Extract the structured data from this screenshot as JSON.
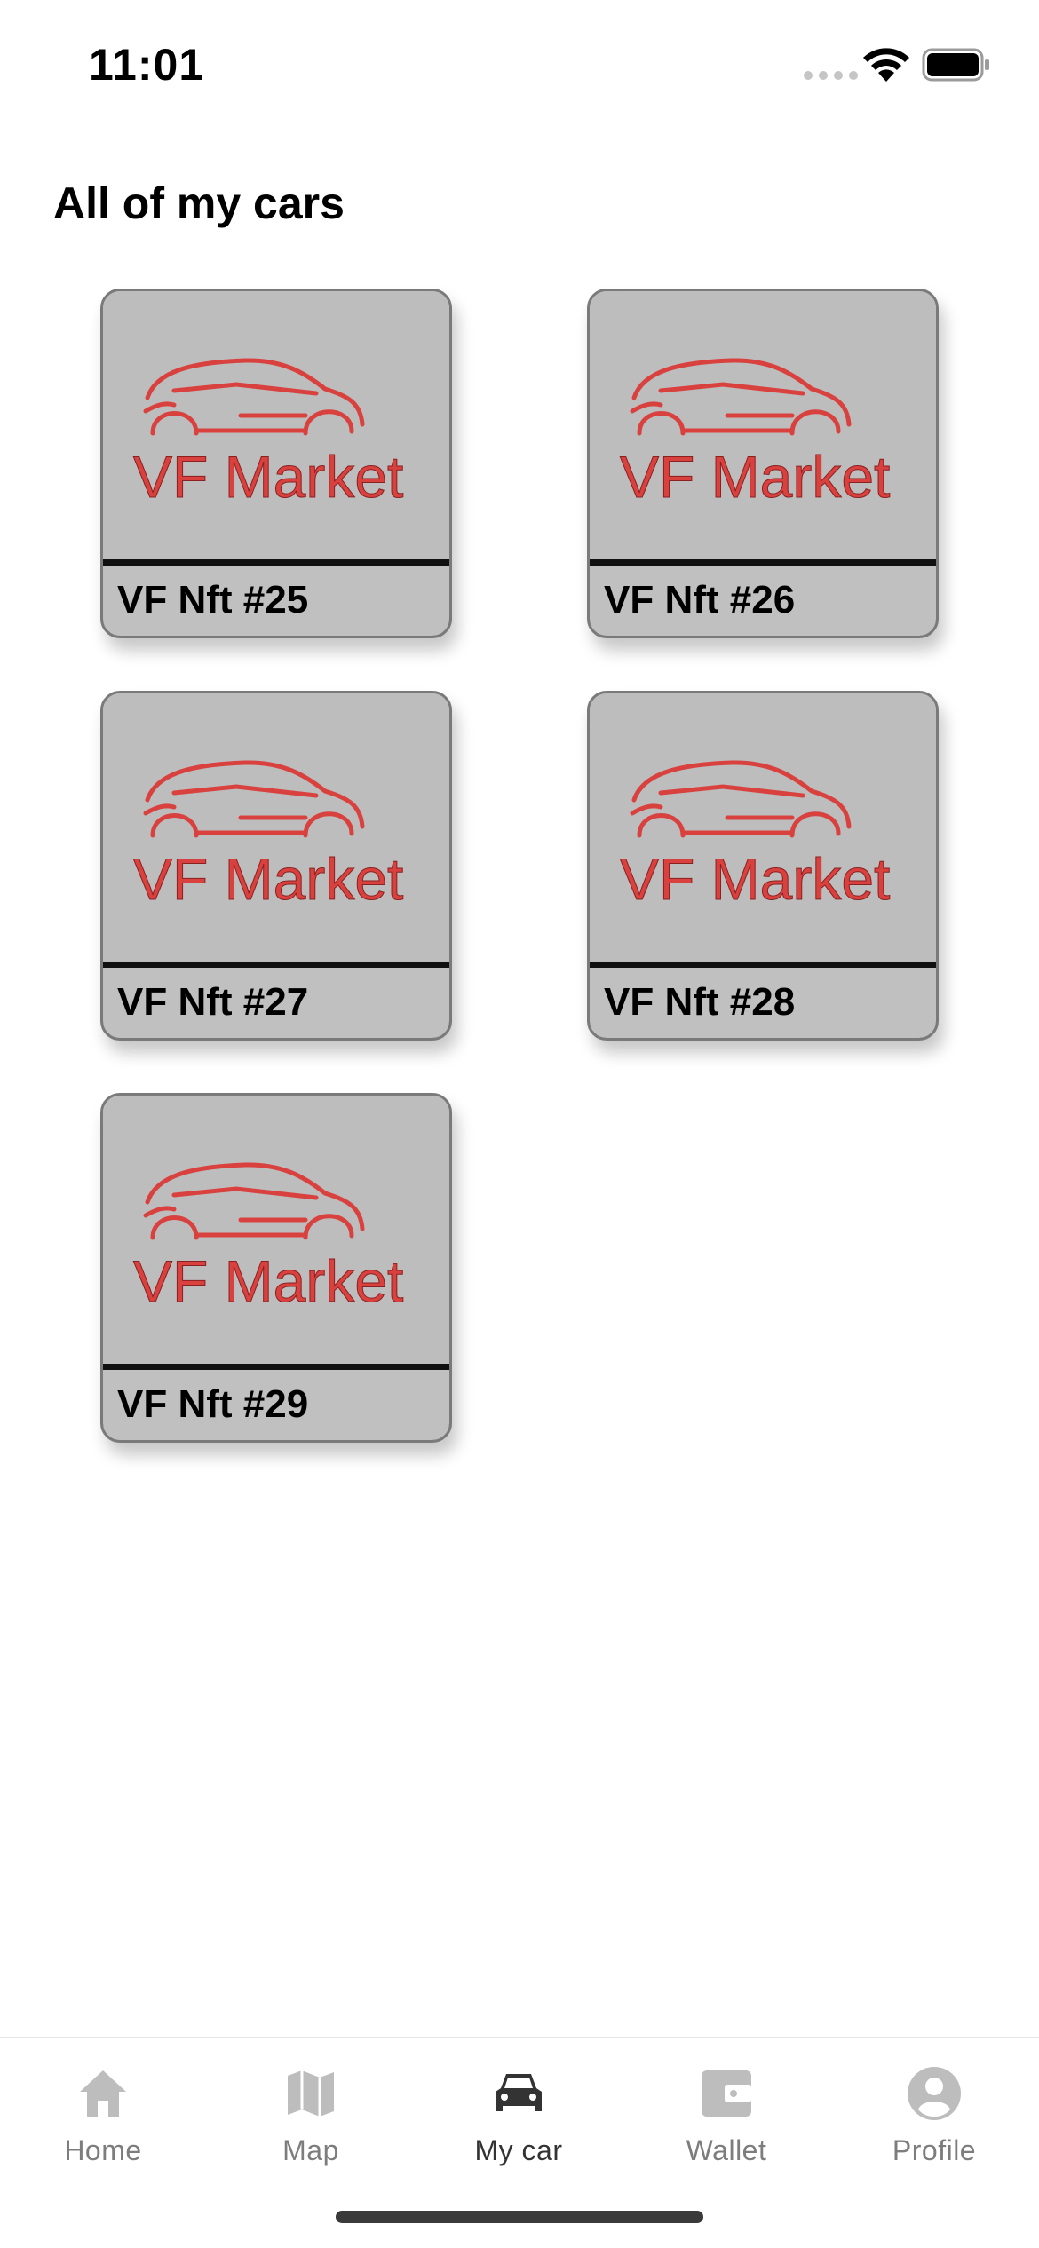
{
  "status_bar": {
    "time": "11:01"
  },
  "page": {
    "title": "All of my cars"
  },
  "cars": [
    {
      "logo_text": "VF Market",
      "name": "VF Nft #25"
    },
    {
      "logo_text": "VF Market",
      "name": "VF Nft #26"
    },
    {
      "logo_text": "VF Market",
      "name": "VF Nft #27"
    },
    {
      "logo_text": "VF Market",
      "name": "VF Nft #28"
    },
    {
      "logo_text": "VF Market",
      "name": "VF Nft #29"
    }
  ],
  "bottom_nav": {
    "items": [
      {
        "label": "Home",
        "icon": "home-icon"
      },
      {
        "label": "Map",
        "icon": "map-icon"
      },
      {
        "label": "My car",
        "icon": "car-icon",
        "active": true
      },
      {
        "label": "Wallet",
        "icon": "wallet-icon"
      },
      {
        "label": "Profile",
        "icon": "profile-icon"
      }
    ],
    "active_color": "#333333",
    "inactive_color": "#bdbdbd"
  },
  "colors": {
    "logo_red": "#d9413f",
    "card_bg": "#c0c0c0"
  }
}
